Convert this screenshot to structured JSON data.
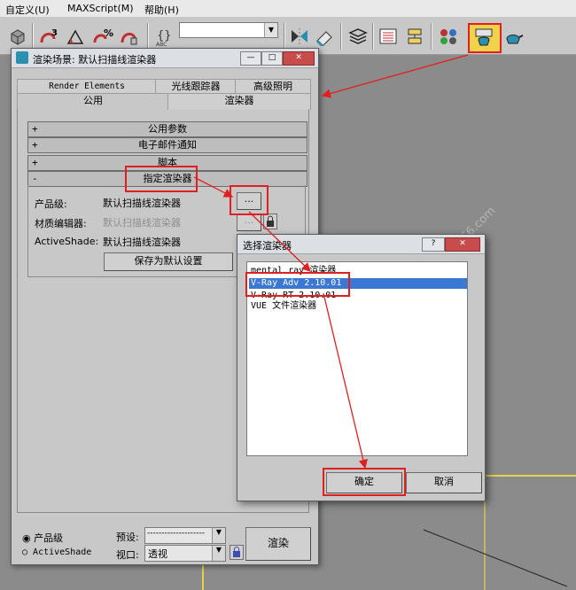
{
  "menubar": {
    "items": [
      "自定义(U)",
      "MAXScript(M)",
      "帮助(H)"
    ]
  },
  "toolbar": {
    "snap_labels": [
      "3",
      "%"
    ],
    "selection_set_value": ""
  },
  "render_dialog": {
    "title": "渲染场景: 默认扫描线渲染器",
    "tabs_row1": [
      "Render Elements",
      "光线跟踪器",
      "高级照明"
    ],
    "tabs_row2": [
      "公用",
      "渲染器"
    ],
    "rollouts": [
      {
        "sign": "+",
        "label": "公用参数"
      },
      {
        "sign": "+",
        "label": "电子邮件通知"
      },
      {
        "sign": "+",
        "label": "脚本"
      },
      {
        "sign": "-",
        "label": "指定渲染器"
      }
    ],
    "production_label": "产品级:",
    "production_value": "默认扫描线渲染器",
    "material_editor_label": "材质编辑器:",
    "material_editor_value": "默认扫描线渲染器",
    "activeshade_label": "ActiveShade:",
    "activeshade_value": "默认扫描线渲染器",
    "browse_label": "...",
    "save_default_label": "保存为默认设置",
    "radio_production": "产品级",
    "radio_activeshade": "ActiveShade",
    "preset_label": "预设:",
    "preset_value": "--------------------",
    "viewport_label": "视口:",
    "viewport_value": "透视",
    "render_button": "渲染"
  },
  "choose_dialog": {
    "title": "选择渲染器",
    "help_label": "?",
    "close_label": "✕",
    "items": [
      "mental ray 渲染器",
      "V-Ray Adv 2.10.01",
      "V-Ray RT 2.10.01",
      "VUE 文件渲染器"
    ],
    "selected_index": 1,
    "ok_label": "确定",
    "cancel_label": "取消"
  },
  "colors": {
    "annotation_red": "#e02020",
    "selection_blue": "#3b78d4",
    "viewport_yellow": "#e7d24b"
  }
}
